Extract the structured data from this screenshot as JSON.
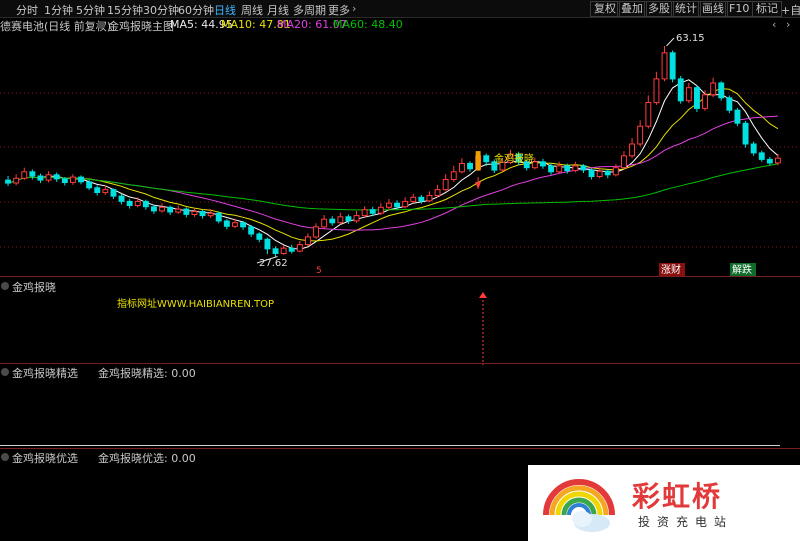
{
  "toolbar": {
    "periods": [
      "分时",
      "1分钟",
      "5分钟",
      "15分钟",
      "30分钟",
      "60分钟",
      "日线",
      "周线",
      "月线",
      "多周期",
      "更多"
    ],
    "active_period": "日线",
    "buttons": [
      "复权",
      "叠加",
      "多股",
      "统计",
      "画线",
      "F10",
      "标记"
    ],
    "more_arrow": "›",
    "auto_label": "+自"
  },
  "info": {
    "stock_name": "德赛电池(日线 前复权)",
    "indicator_name": "金鸡报晓主图",
    "ma5": "MA5: 44.95",
    "ma10": "MA10: 47.81",
    "ma20": "MA20: 61.07",
    "ma60": "MA60: 48.40",
    "nav_left": "‹",
    "nav_right": "›"
  },
  "colors": {
    "up": "#ff3b3b",
    "down": "#00e0e0",
    "ma5": "#ffffff",
    "ma10": "#e8e000",
    "ma20": "#e040e0",
    "ma60": "#00c000",
    "grid": "#8a1a1a",
    "signal": "#ff3b3b",
    "url_text": "#e8e000"
  },
  "chart_data": {
    "type": "candlestick",
    "high_label": "63.15",
    "low_label": "27.62",
    "signal_label": "金鸡报晓",
    "signal_marker": "5",
    "badges": [
      "涨财",
      "解跌"
    ],
    "panel1_title": "金鸡报晓",
    "url_text": "指标网址WWW.HAIBIANREN.TOP",
    "panel2_title": "金鸡报晓精选",
    "panel2_value": "金鸡报晓精选: 0.00",
    "panel3_title": "金鸡报晓优选",
    "panel3_value": "金鸡报晓优选: 0.00",
    "candles": [
      [
        40.5,
        40.0,
        41.2,
        39.5
      ],
      [
        40.0,
        40.8,
        41.5,
        39.6
      ],
      [
        40.8,
        41.9,
        42.6,
        40.5
      ],
      [
        41.9,
        41.2,
        42.3,
        40.6
      ],
      [
        41.2,
        40.5,
        41.6,
        40.0
      ],
      [
        40.5,
        41.4,
        42.0,
        40.1
      ],
      [
        41.4,
        40.7,
        41.8,
        40.2
      ],
      [
        40.7,
        40.1,
        41.0,
        39.6
      ],
      [
        40.1,
        41.0,
        41.5,
        39.7
      ],
      [
        41.0,
        40.2,
        41.3,
        39.8
      ],
      [
        40.2,
        39.2,
        40.5,
        38.8
      ],
      [
        39.2,
        38.4,
        39.6,
        37.9
      ],
      [
        38.4,
        38.9,
        39.6,
        38.0
      ],
      [
        38.9,
        37.8,
        39.1,
        37.3
      ],
      [
        37.8,
        36.9,
        38.2,
        36.4
      ],
      [
        36.9,
        36.2,
        37.3,
        35.7
      ],
      [
        36.2,
        36.9,
        37.6,
        35.9
      ],
      [
        36.9,
        36.0,
        37.2,
        35.5
      ],
      [
        36.0,
        35.3,
        36.4,
        34.8
      ],
      [
        35.3,
        35.9,
        36.6,
        35.0
      ],
      [
        35.9,
        35.1,
        36.2,
        34.6
      ],
      [
        35.1,
        35.6,
        36.2,
        34.8
      ],
      [
        35.6,
        34.7,
        35.9,
        34.2
      ],
      [
        34.7,
        35.2,
        35.8,
        34.3
      ],
      [
        35.2,
        34.5,
        35.5,
        34.0
      ],
      [
        34.5,
        34.9,
        35.6,
        34.1
      ],
      [
        34.9,
        33.6,
        35.2,
        33.2
      ],
      [
        33.6,
        32.7,
        33.9,
        32.2
      ],
      [
        32.7,
        33.3,
        34.0,
        32.4
      ],
      [
        33.3,
        32.6,
        33.6,
        32.1
      ],
      [
        32.6,
        31.4,
        32.9,
        30.9
      ],
      [
        31.4,
        30.5,
        31.7,
        30.0
      ],
      [
        30.5,
        28.9,
        30.8,
        28.0
      ],
      [
        28.9,
        28.1,
        29.3,
        27.6
      ],
      [
        28.1,
        29.0,
        29.5,
        27.9
      ],
      [
        29.0,
        28.5,
        29.6,
        28.1
      ],
      [
        28.5,
        29.6,
        30.2,
        28.3
      ],
      [
        29.6,
        30.9,
        31.5,
        29.3
      ],
      [
        30.9,
        32.6,
        33.2,
        30.6
      ],
      [
        32.6,
        33.9,
        34.6,
        32.3
      ],
      [
        33.9,
        33.3,
        34.4,
        32.8
      ],
      [
        33.3,
        34.3,
        35.0,
        33.0
      ],
      [
        34.3,
        33.6,
        34.7,
        33.1
      ],
      [
        33.6,
        34.5,
        35.3,
        33.3
      ],
      [
        34.5,
        35.5,
        36.1,
        34.2
      ],
      [
        35.5,
        34.9,
        36.0,
        34.4
      ],
      [
        34.9,
        35.9,
        36.6,
        34.6
      ],
      [
        35.9,
        36.6,
        37.3,
        35.5
      ],
      [
        36.6,
        36.0,
        37.1,
        35.5
      ],
      [
        36.0,
        36.9,
        37.6,
        35.7
      ],
      [
        36.9,
        37.6,
        38.2,
        36.6
      ],
      [
        37.6,
        37.0,
        38.0,
        36.5
      ],
      [
        37.0,
        37.9,
        38.6,
        36.8
      ],
      [
        37.9,
        38.9,
        39.7,
        37.6
      ],
      [
        38.9,
        40.6,
        41.5,
        38.6
      ],
      [
        40.6,
        41.9,
        42.9,
        40.2
      ],
      [
        41.9,
        43.3,
        44.2,
        41.6
      ],
      [
        43.3,
        42.4,
        43.7,
        41.9
      ],
      [
        42.4,
        44.6,
        45.4,
        42.1
      ],
      [
        44.6,
        43.6,
        45.0,
        42.9
      ],
      [
        43.6,
        42.2,
        44.0,
        41.7
      ],
      [
        42.2,
        43.5,
        44.2,
        41.9
      ],
      [
        43.5,
        44.9,
        45.6,
        43.2
      ],
      [
        44.9,
        43.6,
        45.3,
        43.0
      ],
      [
        43.6,
        42.6,
        44.0,
        42.1
      ],
      [
        42.6,
        43.6,
        44.3,
        42.3
      ],
      [
        43.6,
        42.9,
        44.1,
        42.4
      ],
      [
        42.9,
        41.9,
        43.3,
        41.4
      ],
      [
        41.9,
        42.9,
        43.6,
        41.6
      ],
      [
        42.9,
        42.1,
        43.3,
        41.6
      ],
      [
        42.1,
        42.9,
        43.6,
        41.8
      ],
      [
        42.9,
        42.2,
        43.2,
        41.7
      ],
      [
        42.2,
        41.1,
        42.5,
        40.6
      ],
      [
        41.1,
        42.0,
        42.6,
        40.8
      ],
      [
        42.0,
        41.4,
        42.3,
        40.8
      ],
      [
        41.4,
        42.6,
        43.2,
        41.1
      ],
      [
        42.6,
        44.6,
        45.4,
        42.3
      ],
      [
        44.6,
        46.6,
        47.6,
        44.2
      ],
      [
        46.6,
        49.6,
        50.6,
        46.2
      ],
      [
        49.6,
        53.6,
        54.8,
        49.2
      ],
      [
        53.6,
        57.6,
        58.8,
        53.2
      ],
      [
        57.6,
        62.0,
        63.15,
        57.2
      ],
      [
        62.0,
        57.6,
        62.4,
        57.0
      ],
      [
        57.6,
        53.9,
        58.1,
        53.4
      ],
      [
        53.9,
        56.1,
        56.9,
        53.5
      ],
      [
        56.1,
        52.6,
        56.5,
        52.0
      ],
      [
        52.6,
        54.9,
        55.7,
        52.2
      ],
      [
        54.9,
        56.9,
        57.8,
        54.5
      ],
      [
        56.9,
        54.4,
        57.2,
        53.9
      ],
      [
        54.4,
        52.3,
        54.8,
        51.8
      ],
      [
        52.3,
        50.1,
        52.7,
        49.6
      ],
      [
        50.1,
        46.6,
        50.5,
        46.0
      ],
      [
        46.6,
        45.1,
        47.0,
        44.6
      ],
      [
        45.1,
        44.0,
        45.5,
        43.6
      ],
      [
        44.0,
        43.4,
        44.4,
        43.0
      ],
      [
        43.4,
        44.2,
        44.9,
        43.0
      ]
    ]
  }
}
